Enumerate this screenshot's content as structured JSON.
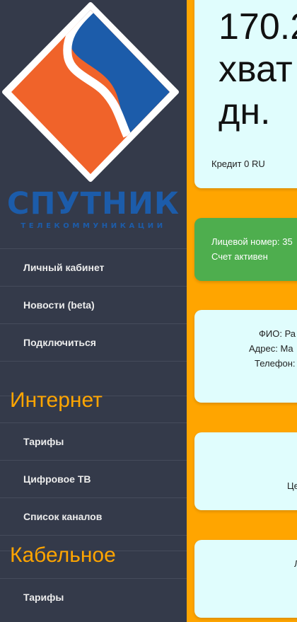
{
  "brand": {
    "name": "СПУТНИК",
    "tagline": "ТЕЛЕКОММУНИКАЦИИ",
    "colors": {
      "blue": "#1c5caa",
      "orange": "#f0632a",
      "accent": "#ffa500",
      "sidebar": "#343a4a"
    }
  },
  "nav": {
    "top_items": [
      {
        "label": "Личный кабинет"
      },
      {
        "label": "Новости (beta)"
      },
      {
        "label": "Подключиться"
      }
    ],
    "internet": {
      "title": "Интернет",
      "items": [
        {
          "label": "Тарифы"
        },
        {
          "label": "Цифровое ТВ"
        },
        {
          "label": "Список каналов"
        }
      ]
    },
    "cable": {
      "title": "Кабельное",
      "items": [
        {
          "label": "Тарифы"
        }
      ]
    }
  },
  "main": {
    "balance": {
      "line1": "170.2",
      "line2": "хват",
      "line3": "дн.",
      "credit": "Кредит 0 RU"
    },
    "account": {
      "number_label": "Лицевой номер: 35",
      "status": "Счет активен"
    },
    "user": {
      "name_label": "ФИО: Ра",
      "address_label": "Адрес: Ма",
      "phone_label": "Телефон:"
    },
    "card4": {
      "text": "Це"
    },
    "card5": {
      "text": "Л"
    }
  }
}
